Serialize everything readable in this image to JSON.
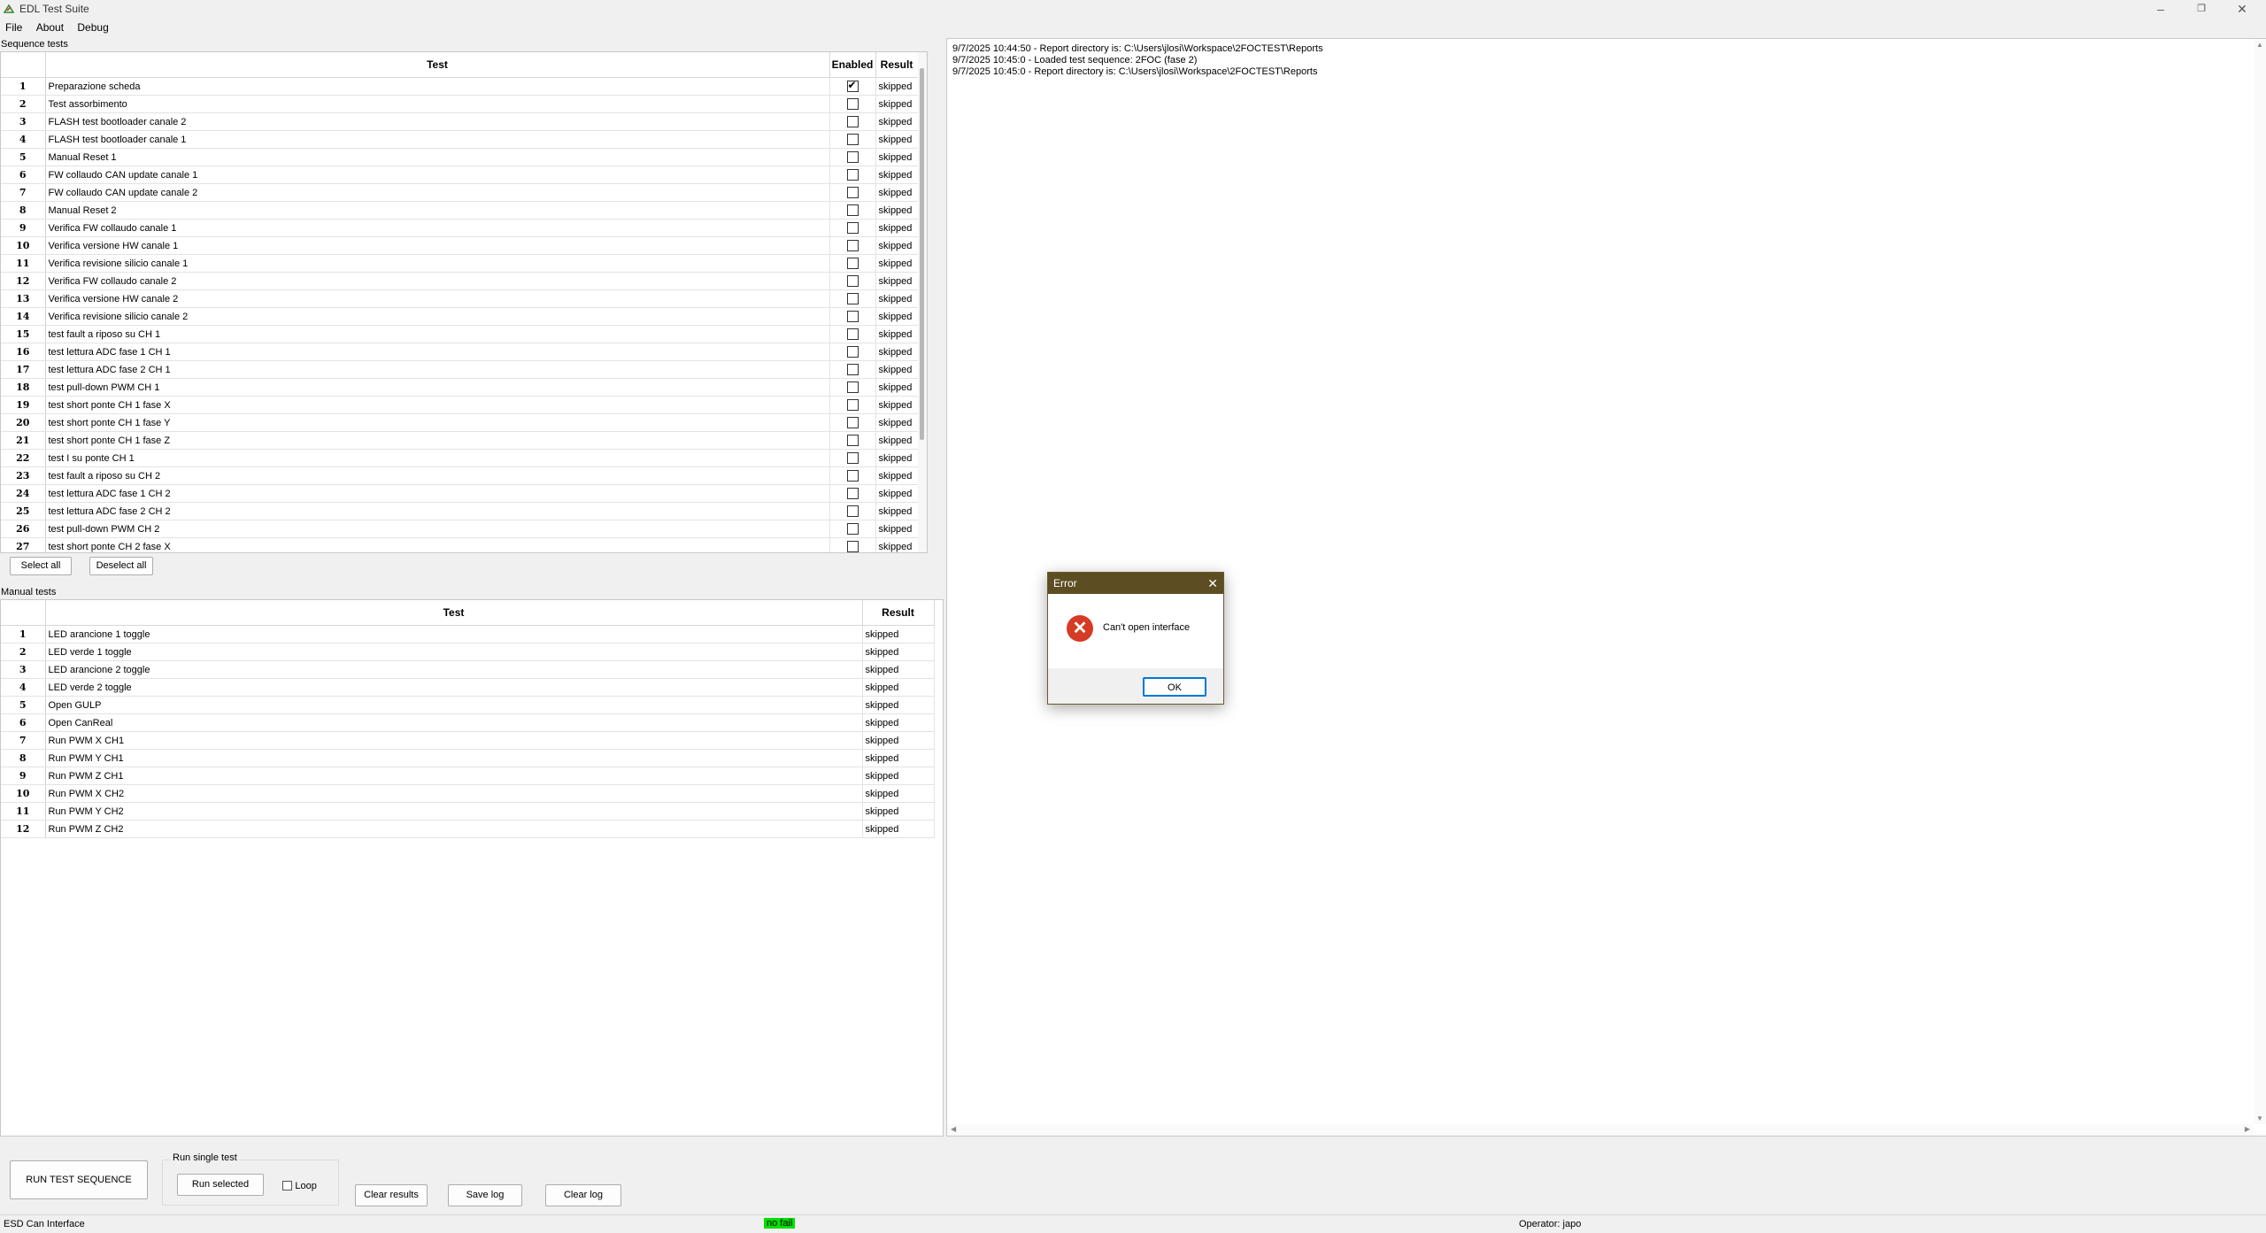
{
  "window": {
    "title": "EDL Test Suite"
  },
  "menu": [
    "File",
    "About",
    "Debug"
  ],
  "sequence": {
    "label": "Sequence tests",
    "headers": {
      "test": "Test",
      "enabled": "Enabled",
      "result": "Result"
    },
    "rows": [
      {
        "n": "1",
        "name": "Preparazione scheda",
        "enabled": true,
        "result": "skipped"
      },
      {
        "n": "2",
        "name": "Test assorbimento",
        "enabled": false,
        "result": "skipped"
      },
      {
        "n": "3",
        "name": "FLASH test bootloader canale 2",
        "enabled": false,
        "result": "skipped"
      },
      {
        "n": "4",
        "name": "FLASH test bootloader canale 1",
        "enabled": false,
        "result": "skipped"
      },
      {
        "n": "5",
        "name": "Manual Reset 1",
        "enabled": false,
        "result": "skipped"
      },
      {
        "n": "6",
        "name": "FW collaudo CAN update canale 1",
        "enabled": false,
        "result": "skipped"
      },
      {
        "n": "7",
        "name": "FW collaudo CAN update canale 2",
        "enabled": false,
        "result": "skipped"
      },
      {
        "n": "8",
        "name": "Manual Reset 2",
        "enabled": false,
        "result": "skipped"
      },
      {
        "n": "9",
        "name": "Verifica FW collaudo canale 1",
        "enabled": false,
        "result": "skipped"
      },
      {
        "n": "10",
        "name": "Verifica versione HW canale 1",
        "enabled": false,
        "result": "skipped"
      },
      {
        "n": "11",
        "name": "Verifica revisione silicio canale 1",
        "enabled": false,
        "result": "skipped"
      },
      {
        "n": "12",
        "name": "Verifica FW collaudo canale 2",
        "enabled": false,
        "result": "skipped"
      },
      {
        "n": "13",
        "name": "Verifica versione HW canale 2",
        "enabled": false,
        "result": "skipped"
      },
      {
        "n": "14",
        "name": "Verifica revisione silicio canale 2",
        "enabled": false,
        "result": "skipped"
      },
      {
        "n": "15",
        "name": "test fault a riposo su CH 1",
        "enabled": false,
        "result": "skipped"
      },
      {
        "n": "16",
        "name": "test lettura ADC fase 1 CH 1",
        "enabled": false,
        "result": "skipped"
      },
      {
        "n": "17",
        "name": "test lettura ADC fase 2 CH 1",
        "enabled": false,
        "result": "skipped"
      },
      {
        "n": "18",
        "name": "test pull-down PWM CH 1",
        "enabled": false,
        "result": "skipped"
      },
      {
        "n": "19",
        "name": "test short ponte CH 1 fase X",
        "enabled": false,
        "result": "skipped"
      },
      {
        "n": "20",
        "name": "test short ponte CH 1 fase Y",
        "enabled": false,
        "result": "skipped"
      },
      {
        "n": "21",
        "name": "test short ponte CH 1 fase Z",
        "enabled": false,
        "result": "skipped"
      },
      {
        "n": "22",
        "name": "test I su ponte CH 1",
        "enabled": false,
        "result": "skipped"
      },
      {
        "n": "23",
        "name": "test fault a riposo su CH 2",
        "enabled": false,
        "result": "skipped"
      },
      {
        "n": "24",
        "name": "test lettura ADC fase 1 CH 2",
        "enabled": false,
        "result": "skipped"
      },
      {
        "n": "25",
        "name": "test lettura ADC fase 2 CH 2",
        "enabled": false,
        "result": "skipped"
      },
      {
        "n": "26",
        "name": "test pull-down PWM CH 2",
        "enabled": false,
        "result": "skipped"
      },
      {
        "n": "27",
        "name": "test short ponte CH 2 fase X",
        "enabled": false,
        "result": "skipped"
      }
    ],
    "select_all": "Select all",
    "deselect_all": "Deselect all"
  },
  "manual": {
    "label": "Manual tests",
    "headers": {
      "test": "Test",
      "result": "Result"
    },
    "rows": [
      {
        "n": "1",
        "name": "LED arancione 1 toggle",
        "result": "skipped"
      },
      {
        "n": "2",
        "name": "LED verde 1 toggle",
        "result": "skipped"
      },
      {
        "n": "3",
        "name": "LED arancione 2 toggle",
        "result": "skipped"
      },
      {
        "n": "4",
        "name": "LED verde 2 toggle",
        "result": "skipped"
      },
      {
        "n": "5",
        "name": "Open GULP",
        "result": "skipped"
      },
      {
        "n": "6",
        "name": "Open CanReal",
        "result": "skipped"
      },
      {
        "n": "7",
        "name": "Run PWM X CH1",
        "result": "skipped"
      },
      {
        "n": "8",
        "name": "Run PWM Y CH1",
        "result": "skipped"
      },
      {
        "n": "9",
        "name": "Run PWM Z CH1",
        "result": "skipped"
      },
      {
        "n": "10",
        "name": "Run PWM X CH2",
        "result": "skipped"
      },
      {
        "n": "11",
        "name": "Run PWM Y CH2",
        "result": "skipped"
      },
      {
        "n": "12",
        "name": "Run PWM Z CH2",
        "result": "skipped"
      }
    ]
  },
  "log": [
    "9/7/2025 10:44:50 - Report directory is: C:\\Users\\jlosi\\Workspace\\2FOCTEST\\Reports",
    "9/7/2025 10:45:0 - Loaded test sequence: 2FOC (fase 2)",
    "9/7/2025 10:45:0 - Report directory is: C:\\Users\\jlosi\\Workspace\\2FOCTEST\\Reports"
  ],
  "bottom": {
    "run_sequence": "RUN TEST SEQUENCE",
    "single_label": "Run single test",
    "run_selected": "Run selected",
    "loop": "Loop",
    "clear_results": "Clear results",
    "save_log": "Save log",
    "clear_log": "Clear log"
  },
  "status": {
    "interface": "ESD Can Interface",
    "fail": "no fail",
    "fail_color": "#00e000",
    "operator": "Operator: japo"
  },
  "dialog": {
    "title": "Error",
    "message": "Can't open interface",
    "ok": "OK"
  },
  "icons": [
    "app-icon",
    "minimize-icon",
    "restore-icon",
    "close-icon",
    "error-icon",
    "dialog-close-icon"
  ]
}
